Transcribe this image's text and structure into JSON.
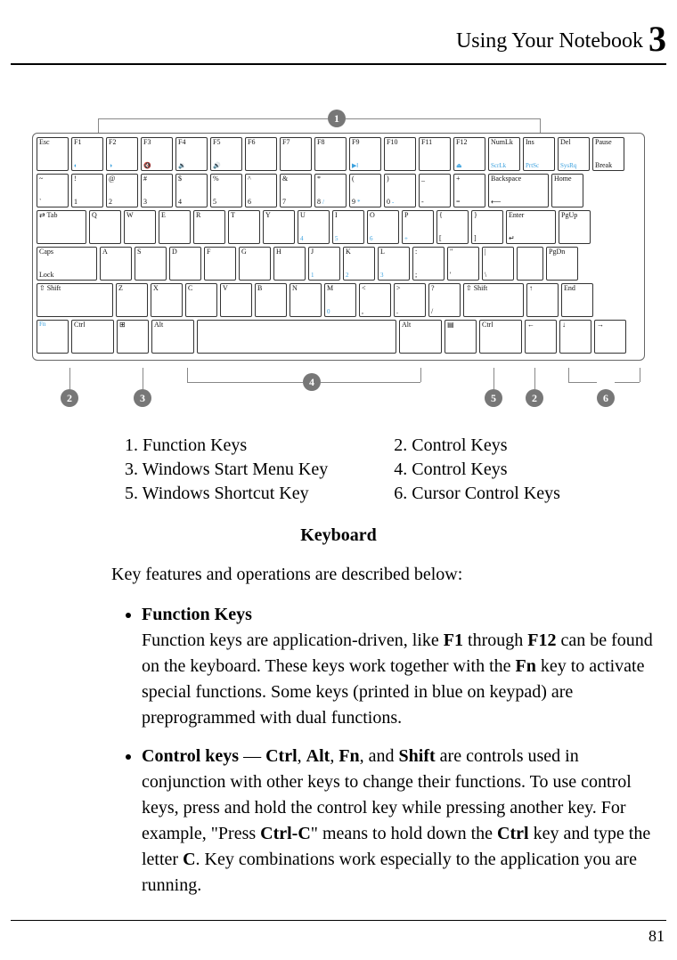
{
  "header": {
    "title": "Using Your Notebook",
    "chapter_number": "3"
  },
  "keyboard": {
    "rows": [
      [
        "Esc",
        "F1",
        "F2",
        "F3",
        "F4",
        "F5",
        "F6",
        "F7",
        "F8",
        "F9",
        "F10",
        "F11",
        "F12",
        "NumLk ScrLk",
        "Ins PrtSc",
        "Del SysRq",
        "Pause Break"
      ],
      [
        "~ `",
        "! 1",
        "@ 2",
        "# 3",
        "$ 4",
        "% 5",
        "^ 6",
        "& 7",
        "* 8",
        "( 9",
        ") 0",
        "_ -",
        "+ =",
        "Backspace",
        "Home"
      ],
      [
        "Tab",
        "Q",
        "W",
        "E",
        "R",
        "T",
        "Y",
        "U",
        "I",
        "O",
        "P",
        "{ [",
        "} ]",
        "Enter",
        "PgUp"
      ],
      [
        "Caps Lock",
        "A",
        "S",
        "D",
        "F",
        "G",
        "H",
        "J",
        "K",
        "L",
        ": ;",
        "\" '",
        "",
        "PgDn"
      ],
      [
        "Shift",
        "Z",
        "X",
        "C",
        "V",
        "B",
        "N",
        "M",
        "< ,",
        "> .",
        "? /",
        "Shift",
        "↑",
        "End"
      ],
      [
        "Fn",
        "Ctrl",
        "Win",
        "Alt",
        "Space",
        "Alt",
        "Menu",
        "Ctrl",
        "←",
        "↓",
        "→"
      ]
    ],
    "callouts": {
      "1": "top",
      "2": "left-bottom",
      "3": "win-key",
      "4": "space",
      "5": "menu-key",
      "6": "arrows"
    }
  },
  "legend": {
    "items": [
      {
        "n": "1",
        "label": "Function Keys"
      },
      {
        "n": "2",
        "label": "Control Keys"
      },
      {
        "n": "3",
        "label": "Windows Start Menu Key"
      },
      {
        "n": "4",
        "label": "Control Keys"
      },
      {
        "n": "5",
        "label": "Windows Shortcut Key"
      },
      {
        "n": "6",
        "label": "Cursor Control Keys"
      }
    ]
  },
  "caption": "Keyboard",
  "intro": "Key features and operations are described below:",
  "bullets": {
    "function_keys": {
      "title": "Function Keys",
      "pre": "Function keys are application-driven, like ",
      "b1": "F1",
      "mid1": " through ",
      "b2": "F12",
      "mid2": " can be found on the keyboard. These keys work together with the ",
      "b3": "Fn",
      "post": " key to activate special functions. Some keys (printed in blue on keypad) are preprogrammed with dual functions."
    },
    "control_keys": {
      "title": "Control keys",
      "dash": " — ",
      "k1": "Ctrl",
      "sep": ", ",
      "k2": "Alt",
      "k3": "Fn",
      "and": ", and ",
      "k4": "Shift",
      "mid1": " are controls used in conjunction with other keys to change their functions. To use control keys, press and hold the control key while pressing another key. For example, \"Press ",
      "combo": "Ctrl-C",
      "mid2": "\" means to hold down the ",
      "k5": "Ctrl",
      "mid3": " key and type the letter ",
      "k6": "C",
      "post": ". Key combinations work especially to the application you are running."
    }
  },
  "page_number": "81"
}
